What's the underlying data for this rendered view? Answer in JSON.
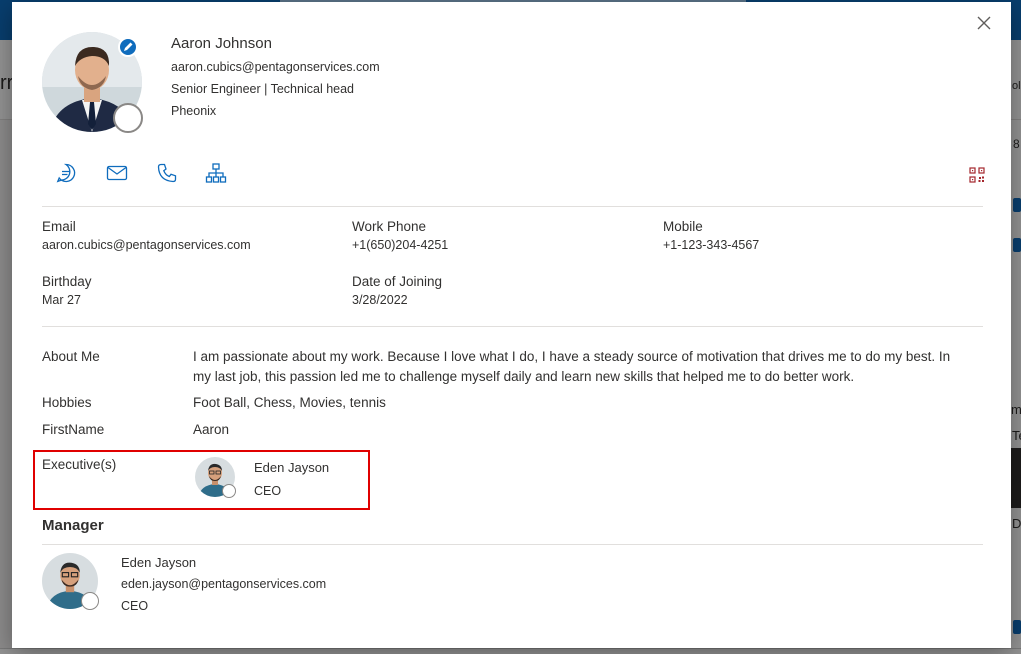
{
  "background": {
    "fragments": [
      "rr",
      "ol",
      "8",
      "m",
      "Te",
      "@",
      "st",
      "D"
    ]
  },
  "profile": {
    "name": "Aaron Johnson",
    "email": "aaron.cubics@pentagonservices.com",
    "title": "Senior Engineer | Technical head",
    "location": "Pheonix"
  },
  "actions": {
    "chat_icon": "chat-icon",
    "mail_icon": "mail-icon",
    "phone_icon": "phone-icon",
    "org_icon": "org-chart-icon",
    "qr_icon": "qr-code-icon"
  },
  "contact": {
    "email_label": "Email",
    "email_value": "aaron.cubics@pentagonservices.com",
    "work_phone_label": "Work Phone",
    "work_phone_value": "+1(650)204-4251",
    "mobile_label": "Mobile",
    "mobile_value": "+1-123-343-4567",
    "birthday_label": "Birthday",
    "birthday_value": "Mar 27",
    "doj_label": "Date of Joining",
    "doj_value": "3/28/2022"
  },
  "details": {
    "about_label": "About Me",
    "about_value": "I am passionate about my work. Because I love what I do, I have a steady source of motivation that drives me to do my best. In my last job, this passion led me to challenge myself daily and learn new skills that helped me to do better work.",
    "hobbies_label": "Hobbies",
    "hobbies_value": "Foot Ball, Chess, Movies, tennis",
    "firstname_label": "FirstName",
    "firstname_value": "Aaron",
    "executives_label": "Executive(s)",
    "executive_name": "Eden Jayson",
    "executive_title": "CEO"
  },
  "manager": {
    "heading": "Manager",
    "name": "Eden Jayson",
    "email": "eden.jayson@pentagonservices.com",
    "title": "CEO"
  },
  "colors": {
    "accent": "#0f6cbd",
    "highlight": "#e00000",
    "qr": "#a4262c"
  }
}
